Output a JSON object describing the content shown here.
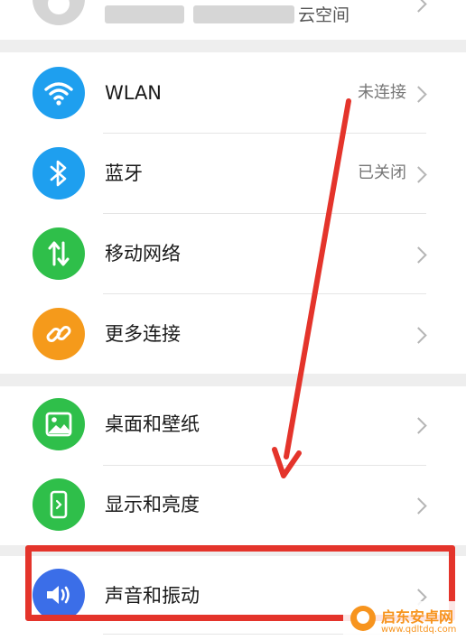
{
  "account": {
    "blurred_text_1": "",
    "blurred_text_2": "",
    "suffix": "云空间",
    "suffix_cut": "丶"
  },
  "settings": {
    "wlan": {
      "label": "WLAN",
      "status": "未连接",
      "icon": "wifi-icon",
      "color": "#1e9fef"
    },
    "bluetooth": {
      "label": "蓝牙",
      "status": "已关闭",
      "icon": "bluetooth-icon",
      "color": "#1e9fef"
    },
    "mobile_network": {
      "label": "移动网络",
      "icon": "mobile-data-icon",
      "color": "#2fbf4a"
    },
    "more_connections": {
      "label": "更多连接",
      "icon": "link-icon",
      "color": "#f59a1b"
    },
    "wallpaper": {
      "label": "桌面和壁纸",
      "icon": "image-icon",
      "color": "#2fbf4a"
    },
    "display": {
      "label": "显示和亮度",
      "icon": "phone-brightness-icon",
      "color": "#2fbf4a"
    },
    "sound": {
      "label": "声音和振动",
      "icon": "speaker-icon",
      "color": "#3b6ee8"
    }
  },
  "annotation": {
    "color": "#e4342b"
  },
  "watermark": {
    "brand": "启东安卓网",
    "url": "www.qdltdq.com",
    "color": "#f7941e"
  }
}
